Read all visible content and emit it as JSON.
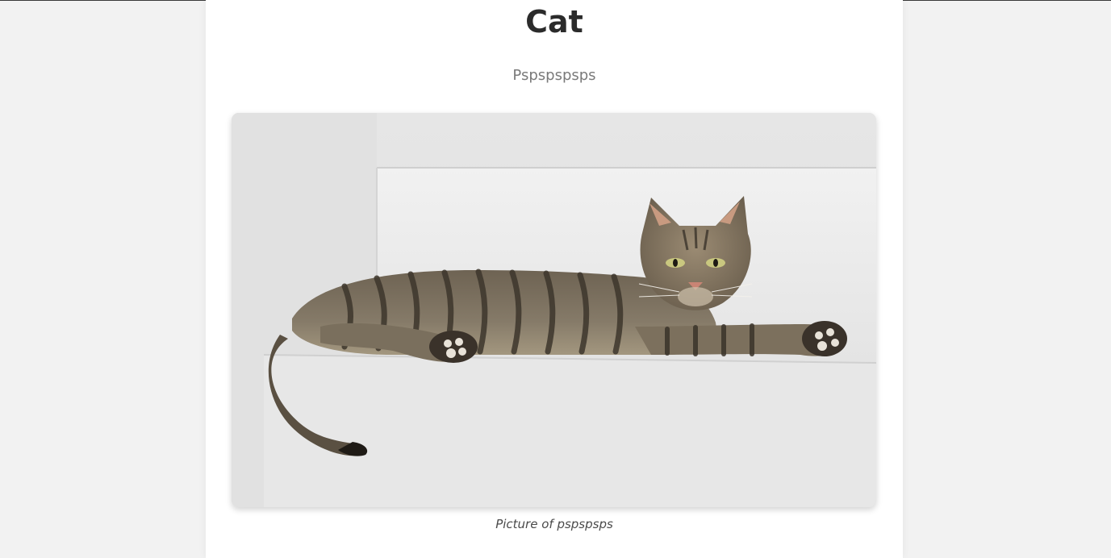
{
  "page": {
    "title": "Cat",
    "subtitle": "Pspspspsps",
    "image_alt": "Picture of pspspsps",
    "caption": "Picture of pspspsps"
  },
  "colors": {
    "background": "#f2f2f2",
    "card": "#ffffff",
    "title": "#2b2b2b",
    "subtitle": "#7a7a7a",
    "caption": "#4a4a4a"
  }
}
